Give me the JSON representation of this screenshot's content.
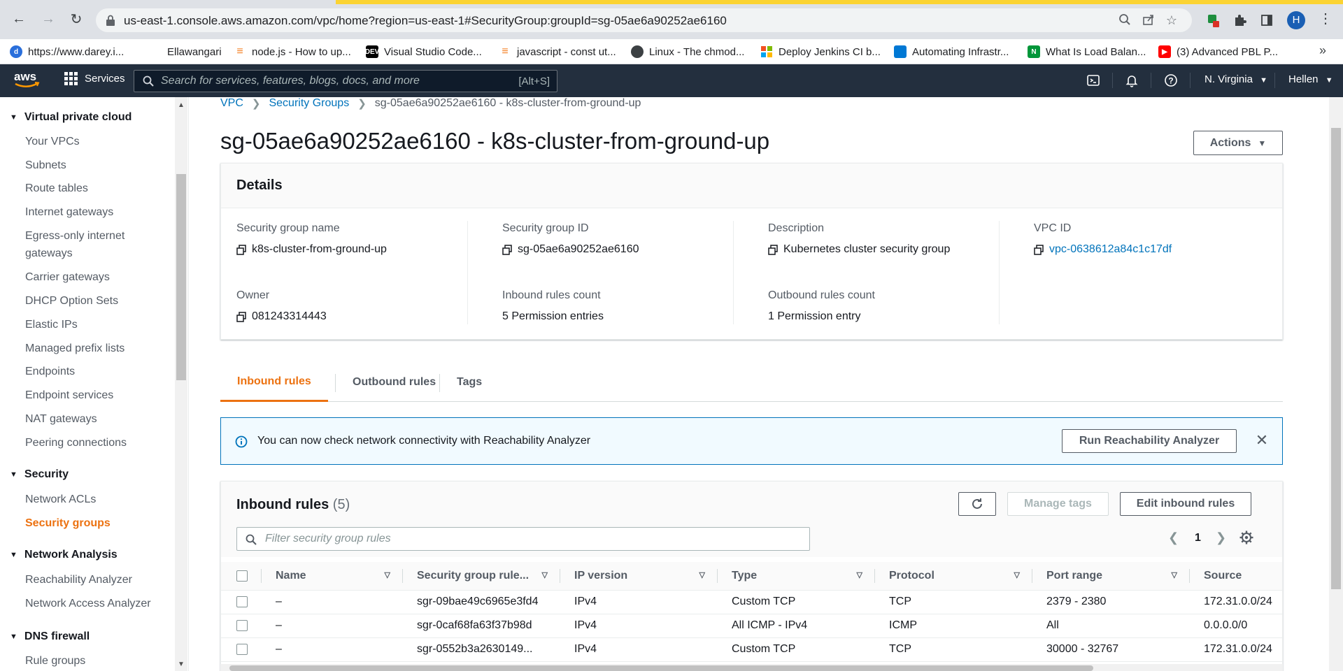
{
  "browser": {
    "url": "us-east-1.console.aws.amazon.com/vpc/home?region=us-east-1#SecurityGroup:groupId=sg-05ae6a90252ae6160",
    "profile_initial": "H",
    "bookmarks": [
      {
        "label": "https://www.darey.i...",
        "icon": "darey-icon",
        "color": "#2a6fdb"
      },
      {
        "label": "Ellawangari",
        "icon": "globe-icon",
        "color": "#ffffff"
      },
      {
        "label": "node.js - How to up...",
        "icon": "stackoverflow-icon",
        "color": "#f48024"
      },
      {
        "label": "Visual Studio Code...",
        "icon": "dev-icon",
        "color": "#000000"
      },
      {
        "label": "javascript - const ut...",
        "icon": "stackoverflow-icon",
        "color": "#f48024"
      },
      {
        "label": "Linux - The chmod...",
        "icon": "globe-icon",
        "color": "#3c4043"
      },
      {
        "label": "Deploy Jenkins CI b...",
        "icon": "microsoft-icon",
        "color": "#f25022"
      },
      {
        "label": "Automating Infrastr...",
        "icon": "azure-devops-icon",
        "color": "#0078d4"
      },
      {
        "label": "What Is Load Balan...",
        "icon": "nginx-icon",
        "color": "#009639"
      },
      {
        "label": "(3) Advanced PBL P...",
        "icon": "youtube-icon",
        "color": "#ff0000"
      }
    ]
  },
  "aws_nav": {
    "services_label": "Services",
    "search_placeholder": "Search for services, features, blogs, docs, and more",
    "search_shortcut": "[Alt+S]",
    "region": "N. Virginia",
    "user": "Hellen"
  },
  "sidebar": {
    "sections": [
      {
        "heading": "Virtual private cloud",
        "items": [
          "Your VPCs",
          "Subnets",
          "Route tables",
          "Internet gateways",
          "Egress-only internet gateways",
          "Carrier gateways",
          "DHCP Option Sets",
          "Elastic IPs",
          "Managed prefix lists",
          "Endpoints",
          "Endpoint services",
          "NAT gateways",
          "Peering connections"
        ]
      },
      {
        "heading": "Security",
        "items": [
          "Network ACLs",
          "Security groups"
        ]
      },
      {
        "heading": "Network Analysis",
        "items": [
          "Reachability Analyzer",
          "Network Access Analyzer"
        ]
      },
      {
        "heading": "DNS firewall",
        "items": [
          "Rule groups"
        ]
      }
    ],
    "active_item": "Security groups"
  },
  "breadcrumb": {
    "items": [
      "VPC",
      "Security Groups"
    ],
    "current": "sg-05ae6a90252ae6160 - k8s-cluster-from-ground-up"
  },
  "page": {
    "title": "sg-05ae6a90252ae6160 - k8s-cluster-from-ground-up",
    "actions_label": "Actions"
  },
  "details": {
    "title": "Details",
    "fields": [
      {
        "label": "Security group name",
        "value": "k8s-cluster-from-ground-up"
      },
      {
        "label": "Security group ID",
        "value": "sg-05ae6a90252ae6160"
      },
      {
        "label": "Description",
        "value": "Kubernetes cluster security group"
      },
      {
        "label": "VPC ID",
        "value": "vpc-0638612a84c1c17df"
      },
      {
        "label": "Owner",
        "value": "081243314443"
      },
      {
        "label": "Inbound rules count",
        "value": "5 Permission entries"
      },
      {
        "label": "Outbound rules count",
        "value": "1 Permission entry"
      }
    ]
  },
  "tabs": [
    "Inbound rules",
    "Outbound rules",
    "Tags"
  ],
  "active_tab": "Inbound rules",
  "banner": {
    "text": "You can now check network connectivity with Reachability Analyzer",
    "button_label": "Run Reachability Analyzer"
  },
  "rules": {
    "title": "Inbound rules",
    "count": "(5)",
    "manage_tags_label": "Manage tags",
    "edit_label": "Edit inbound rules",
    "filter_placeholder": "Filter security group rules",
    "current_page": "1",
    "columns": [
      "Name",
      "Security group rule...",
      "IP version",
      "Type",
      "Protocol",
      "Port range",
      "Source"
    ],
    "rows": [
      [
        "–",
        "sgr-09bae49c6965e3fd4",
        "IPv4",
        "Custom TCP",
        "TCP",
        "2379 - 2380",
        "172.31.0.0/24"
      ],
      [
        "–",
        "sgr-0caf68fa63f37b98d",
        "IPv4",
        "All ICMP - IPv4",
        "ICMP",
        "All",
        "0.0.0.0/0"
      ],
      [
        "–",
        "sgr-0552b3a2630149...",
        "IPv4",
        "Custom TCP",
        "TCP",
        "30000 - 32767",
        "172.31.0.0/24"
      ]
    ]
  },
  "colors": {
    "aws_nav_bg": "#232f3e",
    "accent_orange": "#ec7211",
    "link_blue": "#0073bb",
    "banner_bg": "#f1faff"
  }
}
